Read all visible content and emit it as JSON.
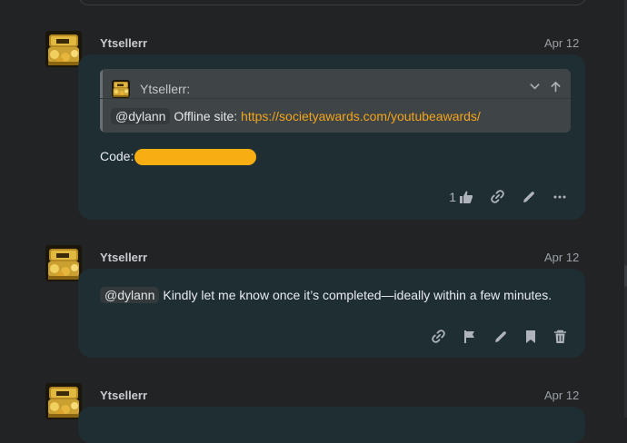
{
  "posts": [
    {
      "username": "Ytsellerr",
      "date": "Apr 12",
      "quote": {
        "author": "Ytsellerr:",
        "mention": "@dylann",
        "text": "Offline site:",
        "link": "https://societyawards.com/youtubeawards/",
        "icons": [
          "chevron-down-icon",
          "arrow-up-icon"
        ]
      },
      "code_label": "Code:",
      "like_count": "1",
      "actions": [
        "like-icon",
        "link-icon",
        "pencil-icon",
        "more-icon"
      ]
    },
    {
      "username": "Ytsellerr",
      "date": "Apr 12",
      "mention": "@dylann",
      "text": "Kindly let me know once it’s completed—ideally within a few minutes.",
      "actions": [
        "link-icon",
        "flag-icon",
        "pencil-icon",
        "bookmark-icon",
        "trash-icon"
      ]
    },
    {
      "username": "Ytsellerr",
      "date": "Apr 12"
    }
  ],
  "colors": {
    "background": "#222325",
    "bubble": "#1e2e33",
    "link": "#f4a51c",
    "redaction": "#f7ae13"
  }
}
